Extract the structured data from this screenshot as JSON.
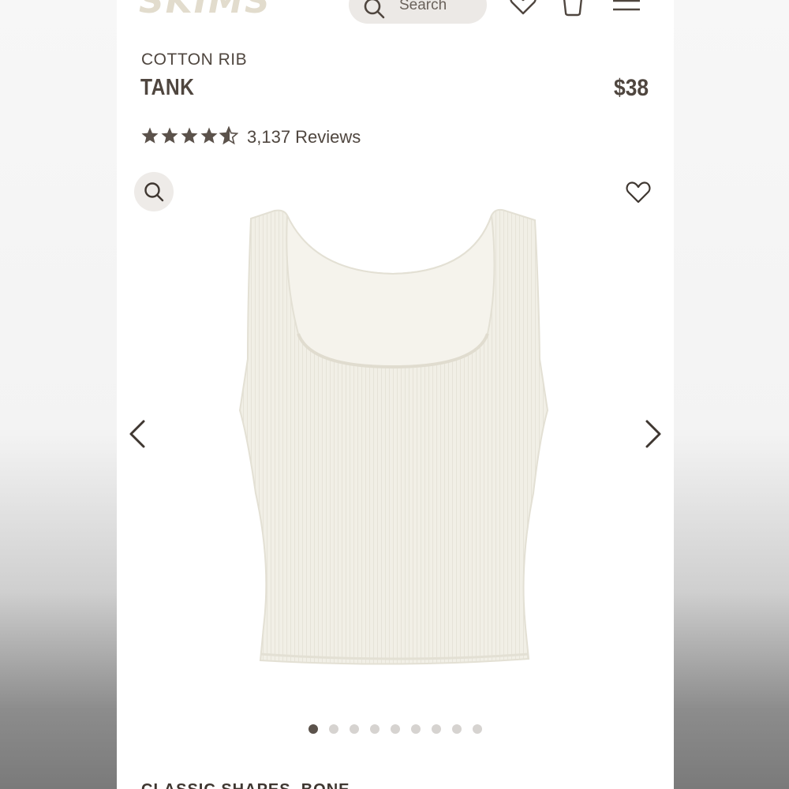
{
  "header": {
    "logo_text": "SKIMS",
    "search_placeholder": "Search",
    "icons": [
      "search-icon",
      "heart-icon",
      "bag-icon",
      "menu-icon"
    ]
  },
  "product": {
    "category": "COTTON RIB",
    "name": "TANK",
    "price": "$38",
    "rating": 4.5,
    "reviews_label": "3,137 Reviews"
  },
  "gallery": {
    "image_count": 9,
    "active_index": 0,
    "icons": [
      "zoom-icon",
      "wishlist-heart-icon",
      "chevron-left-icon",
      "chevron-right-icon"
    ]
  },
  "next_section": {
    "title": "CLASSIC SHAPES, BONE"
  },
  "colors": {
    "text": "#4f463f",
    "logo": "#e2dccd",
    "pill_bg": "#ece9e6",
    "dot_active": "#5b524b",
    "dot_inactive": "#d6d3d0",
    "garment": "#f1efe6"
  }
}
